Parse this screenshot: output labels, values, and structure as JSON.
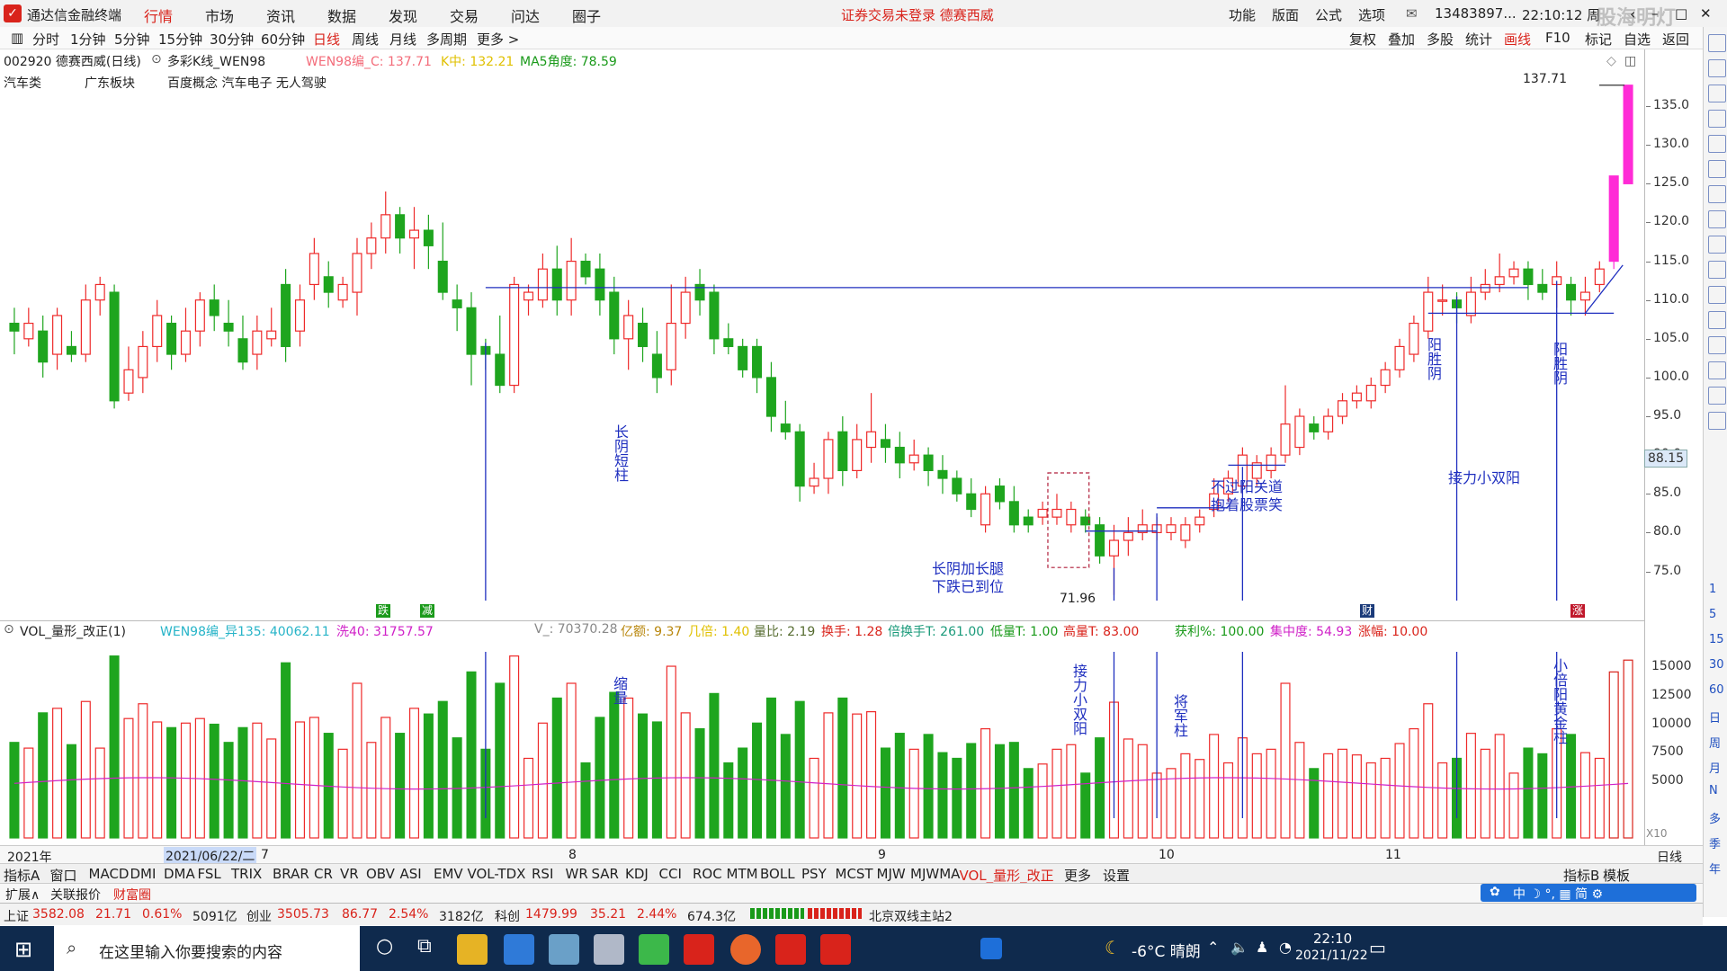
{
  "menubar": {
    "app_title": "通达信金融终端",
    "items": [
      "行情",
      "市场",
      "资讯",
      "数据",
      "发现",
      "交易",
      "问达",
      "圈子"
    ],
    "active": "行情",
    "notice": "证券交易未登录  德赛西威",
    "right_items": [
      "功能",
      "版面",
      "公式",
      "选项"
    ],
    "account": "13483897...",
    "time": "22:10:12 周",
    "watermark": "股海明灯"
  },
  "periodbar": {
    "periods": [
      "分时",
      "1分钟",
      "5分钟",
      "15分钟",
      "30分钟",
      "60分钟",
      "日线",
      "周线",
      "月线",
      "多周期",
      "更多 >"
    ],
    "active": "日线",
    "right_tools": [
      "复权",
      "叠加",
      "多股",
      "统计",
      "画线",
      "F10",
      "标记",
      "自选",
      "返回"
    ]
  },
  "chart_header": {
    "code_name": "002920 德赛西威(日线)",
    "indicator": "多彩K线_WEN98",
    "wen_c": "WEN98编_C: 137.71",
    "k_mid": "K中: 132.21",
    "ma5_angle": "MA5角度: 78.59",
    "sectors": [
      "汽车类",
      "广东板块",
      "百度概念 汽车电子 无人驾驶"
    ]
  },
  "annotations": {
    "long_yin": "长阴短柱",
    "long_leg": "长阴加长腿\n下跌已到位",
    "no_pass": "不过阳关道\n抱着股票笑",
    "relay": "接力小双阳",
    "yang1": "阳胜阴",
    "yang2": "阳胜阴",
    "low_label": "71.96",
    "high_label": "137.71",
    "marker_die": "跌",
    "marker_jian": "减",
    "marker_cai": "财",
    "marker_zhang": "涨",
    "shrink": "缩量",
    "relay_vol": "接力小双阳",
    "general": "将军柱",
    "small_gold": "小倍阳黄金柱"
  },
  "vol_header": {
    "name": "VOL_量形_改正(1)",
    "wen": "WEN98编_异135: 40062.11",
    "xi40": "洗40: 31757.57",
    "v": "V_: 70370.28",
    "amount": "亿额: 9.37",
    "jibei": "几倍: 1.40",
    "liangbi": "量比: 2.19",
    "turnover": "换手: 1.28",
    "bei": "倍换手T: 261.00",
    "low": "低量T: 1.00",
    "high": "高量T: 83.00",
    "profit": "获利%: 100.00",
    "conc": "集中度: 54.93",
    "rise": "涨幅: 10.00"
  },
  "current_price_tag": "88.15",
  "datebar": {
    "labels": [
      "2021年",
      "2021/06/22/二",
      "7",
      "8",
      "9",
      "10",
      "11"
    ],
    "right": "日线"
  },
  "indicator_tabs": {
    "items": [
      "指标A",
      "窗口",
      "MACD",
      "DMI",
      "DMA",
      "FSL",
      "TRIX",
      "BRAR",
      "CR",
      "VR",
      "OBV",
      "ASI",
      "EMV",
      "VOL-TDX",
      "RSI",
      "WR",
      "SAR",
      "KDJ",
      "CCI",
      "ROC",
      "MTM",
      "BOLL",
      "PSY",
      "MCST",
      "MJW",
      "MJWMA",
      "VOL_量形_改正",
      "更多",
      "设置"
    ],
    "active": "VOL_量形_改正",
    "right": [
      "指标B",
      "模板"
    ]
  },
  "extbar": [
    "扩展∧",
    "关联报价",
    "财富圈"
  ],
  "statusbar": {
    "sh_label": "上证",
    "sh": "3582.08",
    "sh_chg": "21.71",
    "sh_pct": "0.61%",
    "sh_amt": "5091亿",
    "cy_label": "创业",
    "cy": "3505.73",
    "cy_chg": "86.77",
    "cy_pct": "2.54%",
    "cy_amt": "3182亿",
    "kc_label": "科创",
    "kc": "1479.99",
    "kc_chg": "35.21",
    "kc_pct": "2.44%",
    "kc_amt": "674.3亿",
    "server": "北京双线主站2"
  },
  "taskbar": {
    "search_placeholder": "在这里输入你要搜索的内容",
    "weather": "-6°C 晴朗",
    "time": "22:10",
    "date": "2021/11/22"
  },
  "right_axis": {
    "price_ticks": [
      "135.0",
      "130.0",
      "125.0",
      "120.0",
      "115.0",
      "110.0",
      "105.0",
      "100.0",
      "95.0",
      "90.0",
      "85.0",
      "80.0",
      "75.0"
    ],
    "vol_ticks": [
      "15000",
      "12500",
      "10000",
      "7500",
      "5000"
    ],
    "vol_unit": "X10"
  },
  "right_tools": [
    "1",
    "5",
    "15",
    "30",
    "60",
    "日",
    "周",
    "月",
    "N",
    "多",
    "季",
    "年"
  ],
  "chart_data": {
    "type": "candlestick",
    "title": "002920 德赛西威(日线)",
    "ylim": [
      71,
      140
    ],
    "x_months": [
      "7",
      "8",
      "9",
      "10",
      "11"
    ],
    "candles": [
      [
        107,
        106,
        103,
        109
      ],
      [
        105,
        107,
        104,
        109
      ],
      [
        106,
        102,
        100,
        108
      ],
      [
        103,
        108,
        101,
        109
      ],
      [
        104,
        103,
        102,
        106
      ],
      [
        103,
        110,
        102,
        112
      ],
      [
        110,
        112,
        108,
        113
      ],
      [
        111,
        97,
        96,
        112
      ],
      [
        98,
        101,
        97,
        104
      ],
      [
        100,
        104,
        98,
        106
      ],
      [
        104,
        108,
        102,
        110
      ],
      [
        107,
        103,
        101,
        108
      ],
      [
        103,
        106,
        102,
        109
      ],
      [
        106,
        110,
        104,
        111
      ],
      [
        110,
        108,
        106,
        112
      ],
      [
        107,
        106,
        104,
        110
      ],
      [
        105,
        102,
        101,
        108
      ],
      [
        103,
        106,
        101,
        108
      ],
      [
        105,
        106,
        104,
        109
      ],
      [
        112,
        104,
        102,
        114
      ],
      [
        106,
        110,
        104,
        112
      ],
      [
        112,
        116,
        110,
        118
      ],
      [
        113,
        111,
        109,
        115
      ],
      [
        110,
        112,
        109,
        113
      ],
      [
        111,
        116,
        108,
        118
      ],
      [
        116,
        118,
        114,
        120
      ],
      [
        118,
        121,
        116,
        124
      ],
      [
        121,
        118,
        116,
        122
      ],
      [
        118,
        119,
        114,
        122
      ],
      [
        119,
        117,
        114,
        121
      ],
      [
        115,
        111,
        110,
        120
      ],
      [
        110,
        109,
        106,
        112
      ],
      [
        109,
        103,
        99,
        111
      ],
      [
        104,
        103,
        101,
        105
      ],
      [
        103,
        99,
        98,
        108
      ],
      [
        99,
        112,
        98,
        113
      ],
      [
        110,
        111,
        108,
        112
      ],
      [
        110,
        114,
        109,
        116
      ],
      [
        114,
        110,
        108,
        117
      ],
      [
        110,
        115,
        108,
        118
      ],
      [
        115,
        113,
        112,
        116
      ],
      [
        114,
        110,
        108,
        116
      ],
      [
        111,
        105,
        103,
        113
      ],
      [
        105,
        108,
        101,
        110
      ],
      [
        107,
        104,
        102,
        109
      ],
      [
        103,
        100,
        98,
        106
      ],
      [
        101,
        107,
        99,
        112
      ],
      [
        107,
        111,
        105,
        113
      ],
      [
        112,
        110,
        108,
        114
      ],
      [
        111,
        105,
        103,
        112
      ],
      [
        105,
        104,
        103,
        107
      ],
      [
        104,
        101,
        100,
        105
      ],
      [
        104,
        100,
        98,
        105
      ],
      [
        100,
        95,
        93,
        102
      ],
      [
        94,
        93,
        92,
        97
      ],
      [
        93,
        86,
        84,
        94
      ],
      [
        86,
        87,
        85,
        89
      ],
      [
        87,
        92,
        85,
        93
      ],
      [
        93,
        88,
        86,
        95
      ],
      [
        88,
        92,
        87,
        94
      ],
      [
        91,
        93,
        89,
        98
      ],
      [
        92,
        91,
        89,
        94
      ],
      [
        91,
        89,
        87,
        93
      ],
      [
        89,
        90,
        88,
        92
      ],
      [
        90,
        88,
        86,
        91
      ],
      [
        88,
        87,
        85,
        90
      ],
      [
        87,
        85,
        84,
        88
      ],
      [
        85,
        83,
        82,
        87
      ],
      [
        81,
        85,
        80,
        86
      ],
      [
        86,
        84,
        83,
        87
      ],
      [
        84,
        81,
        80,
        86
      ],
      [
        82,
        81,
        80,
        83
      ],
      [
        82,
        83,
        81,
        84
      ],
      [
        82,
        83,
        81,
        85
      ],
      [
        81,
        83,
        80,
        84
      ],
      [
        82,
        81,
        80,
        83
      ],
      [
        81,
        77,
        76,
        82
      ],
      [
        77,
        79,
        71.96,
        81
      ],
      [
        79,
        80,
        77,
        82
      ],
      [
        80,
        81,
        79,
        83
      ],
      [
        80,
        81,
        79,
        82
      ],
      [
        80,
        81,
        79,
        82
      ],
      [
        79,
        81,
        78,
        82
      ],
      [
        81,
        82,
        80,
        83
      ],
      [
        83,
        85,
        82,
        87
      ],
      [
        85,
        87,
        84,
        88
      ],
      [
        86,
        90,
        85,
        91
      ],
      [
        87,
        89,
        86,
        90
      ],
      [
        88,
        90,
        87,
        91
      ],
      [
        90,
        94,
        89,
        99
      ],
      [
        91,
        95,
        90,
        96
      ],
      [
        94,
        93,
        92,
        95
      ],
      [
        93,
        95,
        92,
        96
      ],
      [
        95,
        97,
        94,
        98
      ],
      [
        97,
        98,
        96,
        99
      ],
      [
        97,
        99,
        96,
        100
      ],
      [
        99,
        101,
        98,
        102
      ],
      [
        101,
        104,
        100,
        105
      ],
      [
        103,
        107,
        102,
        108
      ],
      [
        106,
        111,
        105,
        113
      ],
      [
        110,
        110,
        108,
        112
      ],
      [
        110,
        109,
        107,
        111
      ],
      [
        108,
        111,
        107,
        113
      ],
      [
        111,
        112,
        110,
        114
      ],
      [
        112,
        113,
        111,
        116
      ],
      [
        113,
        114,
        112,
        115
      ],
      [
        114,
        112,
        110,
        115
      ],
      [
        112,
        111,
        110,
        114
      ],
      [
        112,
        113,
        109,
        115
      ],
      [
        112,
        110,
        108,
        113
      ],
      [
        110,
        111,
        108,
        113
      ],
      [
        112,
        114,
        111,
        115
      ],
      [
        115,
        126,
        114,
        126
      ],
      [
        125,
        137.71,
        125,
        137.71
      ]
    ],
    "volume_ticks": [
      "15000",
      "12500",
      "10000",
      "7500",
      "5000"
    ],
    "last_volume": 70370.28
  }
}
